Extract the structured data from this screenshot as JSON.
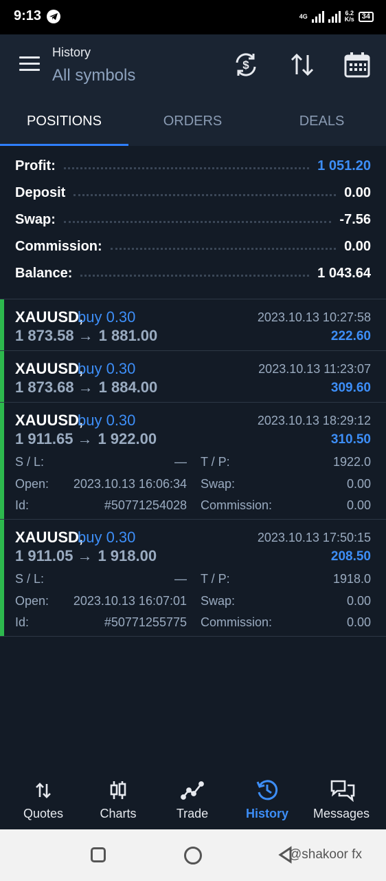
{
  "status_bar": {
    "time": "9:13",
    "network": "4G",
    "speed_value": "6.2",
    "speed_unit": "K/s",
    "battery": "34"
  },
  "header": {
    "title": "History",
    "subtitle": "All symbols",
    "icons": [
      "sync-icon",
      "sort-icon",
      "calendar-icon"
    ]
  },
  "tabs": [
    {
      "label": "POSITIONS",
      "active": true
    },
    {
      "label": "ORDERS",
      "active": false
    },
    {
      "label": "DEALS",
      "active": false
    }
  ],
  "summary": {
    "profit": {
      "label": "Profit:",
      "value": "1 051.20"
    },
    "deposit": {
      "label": "Deposit",
      "value": "0.00"
    },
    "swap": {
      "label": "Swap:",
      "value": "-7.56"
    },
    "commission": {
      "label": "Commission:",
      "value": "0.00"
    },
    "balance": {
      "label": "Balance:",
      "value": "1 043.64"
    }
  },
  "positions": [
    {
      "symbol": "XAUUSD,",
      "side": "buy 0.30",
      "open_price": "1 873.58",
      "close_price": "1 881.00",
      "time": "2023.10.13 10:27:58",
      "profit": "222.60"
    },
    {
      "symbol": "XAUUSD,",
      "side": "buy 0.30",
      "open_price": "1 873.68",
      "close_price": "1 884.00",
      "time": "2023.10.13 11:23:07",
      "profit": "309.60"
    },
    {
      "symbol": "XAUUSD,",
      "side": "buy 0.30",
      "open_price": "1 911.65",
      "close_price": "1 922.00",
      "time": "2023.10.13 18:29:12",
      "profit": "310.50",
      "details": {
        "sl_label": "S / L:",
        "sl": "—",
        "tp_label": "T / P:",
        "tp": "1922.0",
        "open_label": "Open:",
        "open": "2023.10.13 16:06:34",
        "swap_label": "Swap:",
        "swap": "0.00",
        "id_label": "Id:",
        "id": "#50771254028",
        "commission_label": "Commission:",
        "commission": "0.00"
      }
    },
    {
      "symbol": "XAUUSD,",
      "side": "buy 0.30",
      "open_price": "1 911.05",
      "close_price": "1 918.00",
      "time": "2023.10.13 17:50:15",
      "profit": "208.50",
      "details": {
        "sl_label": "S / L:",
        "sl": "—",
        "tp_label": "T / P:",
        "tp": "1918.0",
        "open_label": "Open:",
        "open": "2023.10.13 16:07:01",
        "swap_label": "Swap:",
        "swap": "0.00",
        "id_label": "Id:",
        "id": "#50771255775",
        "commission_label": "Commission:",
        "commission": "0.00"
      }
    }
  ],
  "price_arrow": "→",
  "bottom_nav": [
    {
      "label": "Quotes",
      "icon": "quotes-icon",
      "active": false
    },
    {
      "label": "Charts",
      "icon": "charts-icon",
      "active": false
    },
    {
      "label": "Trade",
      "icon": "trade-icon",
      "active": false
    },
    {
      "label": "History",
      "icon": "history-icon",
      "active": true
    },
    {
      "label": "Messages",
      "icon": "messages-icon",
      "active": false
    }
  ],
  "watermark": "@shakoor fx",
  "colors": {
    "accent": "#3d8ef7",
    "buy_bar": "#2db84d",
    "background": "#131b26",
    "header": "#1a2432"
  }
}
